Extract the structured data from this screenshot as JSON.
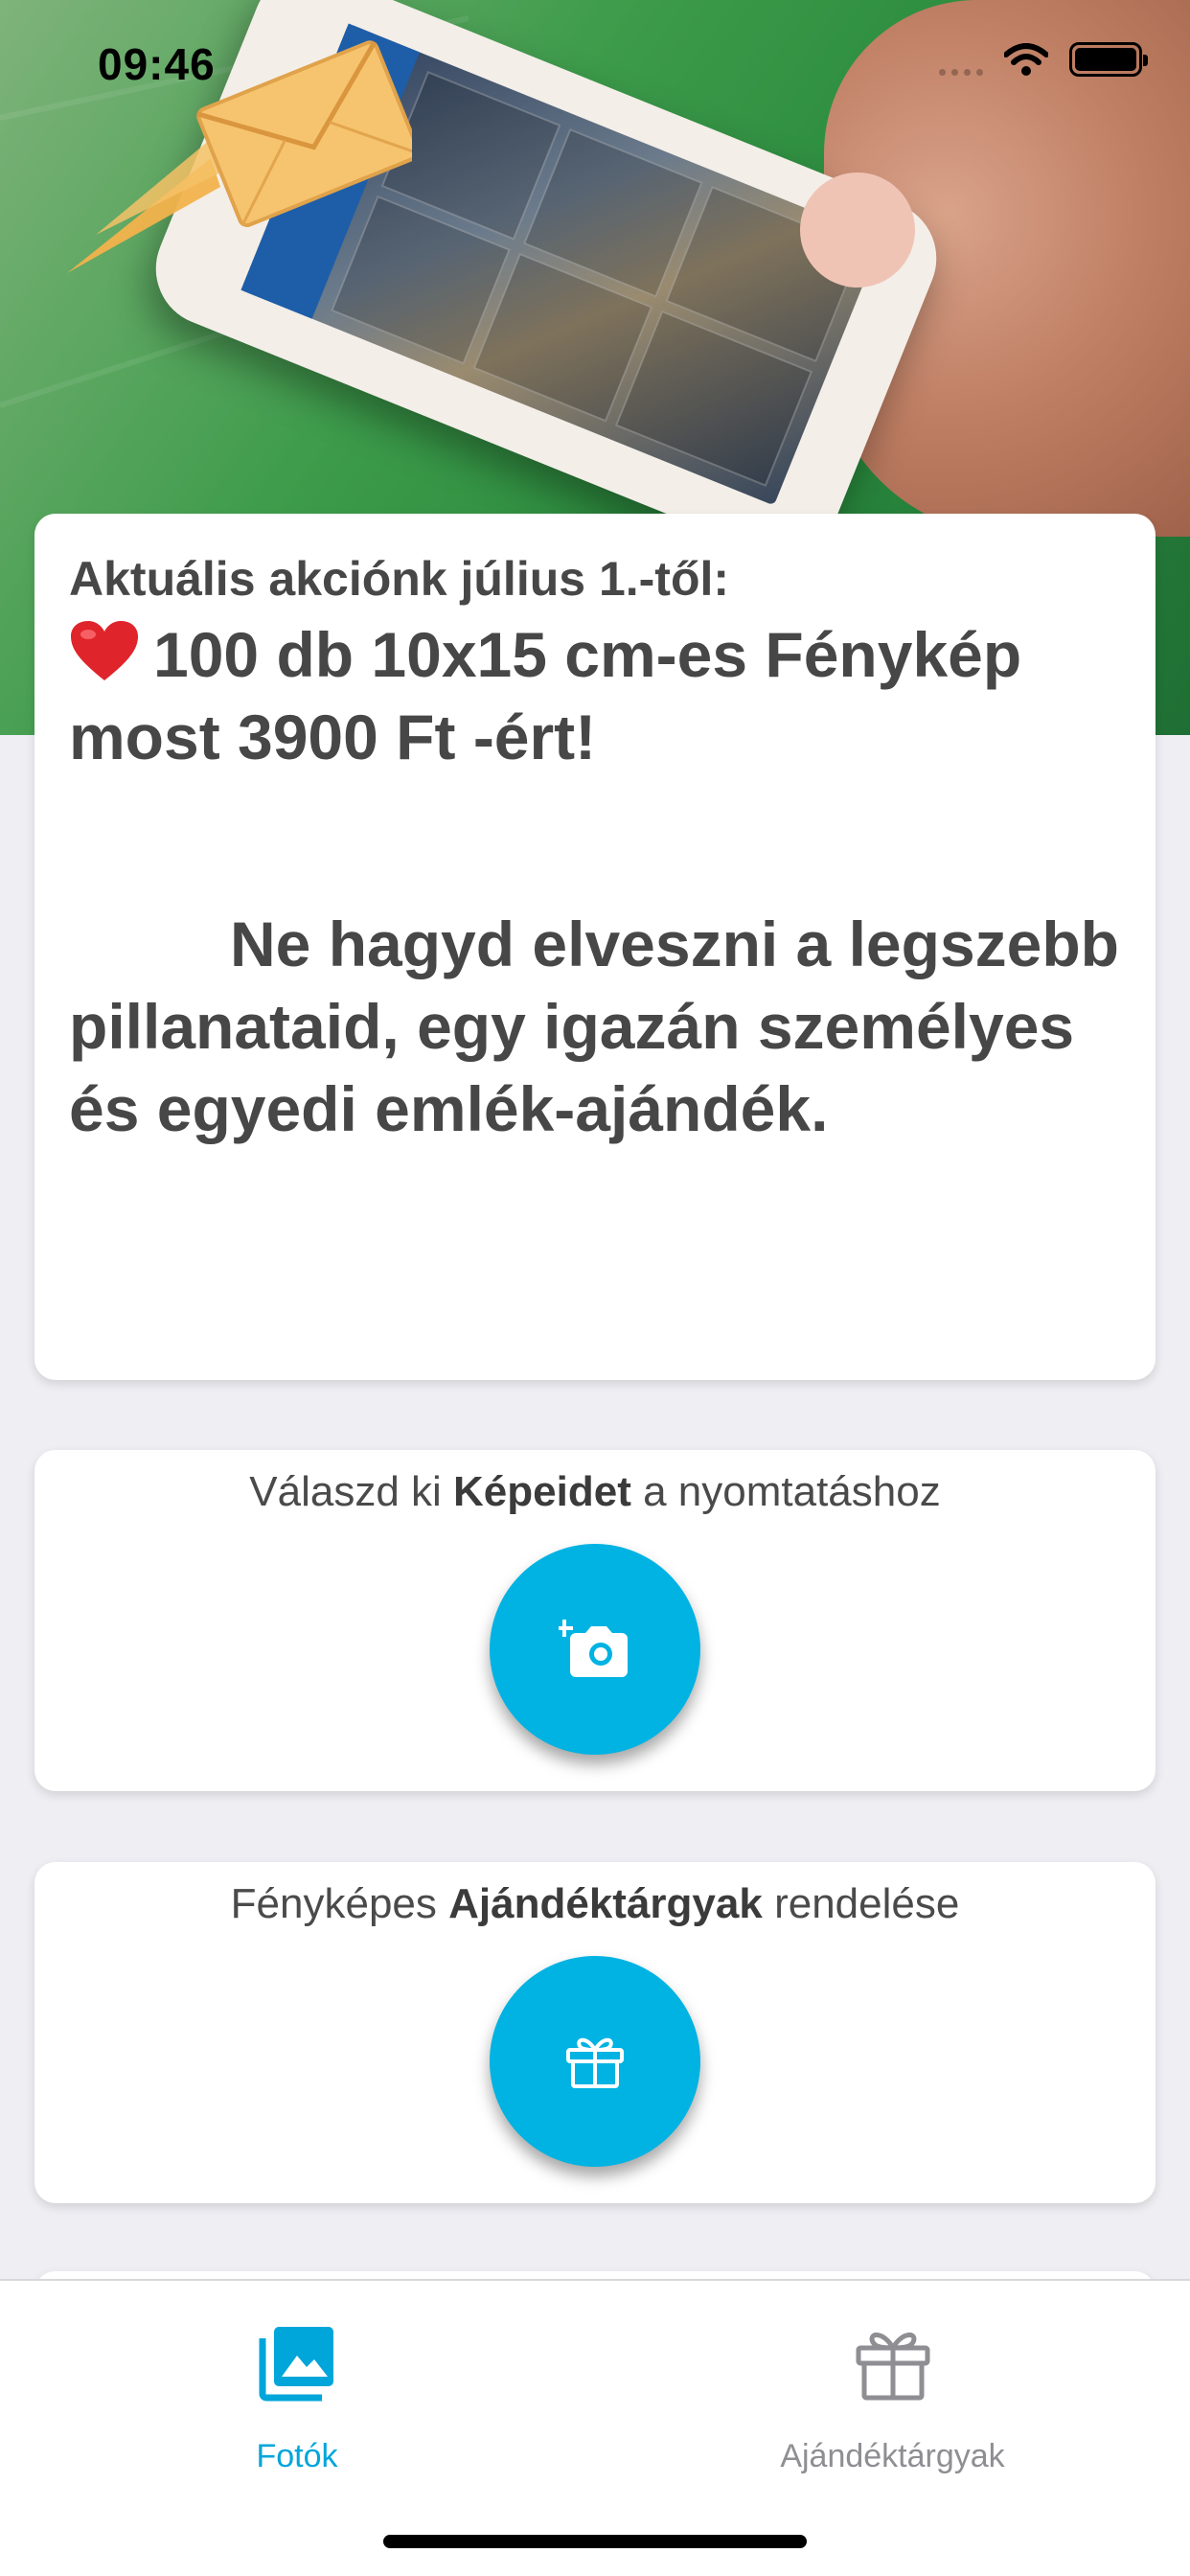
{
  "status_bar": {
    "time": "09:46"
  },
  "promo": {
    "title": "Aktuális akciónk július 1.-től:",
    "offer": "100 db 10x15 cm-es Fénykép most 3900 Ft -ért!",
    "body": "Ne hagyd elveszni a legszebb pillanataid, egy igazán személyes és egyedi emlék-ajándék."
  },
  "actions": {
    "photos": {
      "label_prefix": "Válaszd ki ",
      "label_bold": "Képeidet",
      "label_suffix": " a nyomtatáshoz",
      "icon": "add-photo-icon"
    },
    "gifts": {
      "label_prefix": "Fényképes ",
      "label_bold": "Ajándéktárgyak",
      "label_suffix": " rendelése",
      "icon": "gift-icon"
    }
  },
  "tabbar": {
    "tabs": [
      {
        "label": "Fotók",
        "icon": "photo-library-icon",
        "active": true
      },
      {
        "label": "Ajándéktárgyak",
        "icon": "gift-icon",
        "active": false
      }
    ]
  },
  "colors": {
    "accent": "#00b3e3",
    "tab_active": "#00a6da",
    "tab_inactive": "#8e8e93",
    "background": "#eeeef3",
    "hero_green": "#2a8a3d",
    "heart": "#e0242b"
  }
}
